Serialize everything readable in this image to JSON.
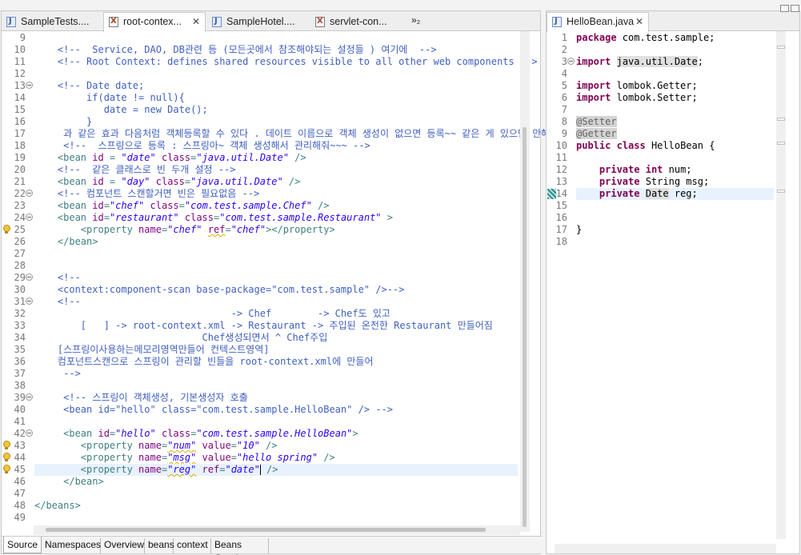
{
  "left_tabs": [
    {
      "label": "SampleTests....",
      "icon": "java-file-icon"
    },
    {
      "label": "root-contex...",
      "icon": "xml-file-icon",
      "active": true
    },
    {
      "label": "SampleHotel....",
      "icon": "java-file-icon"
    },
    {
      "label": "servlet-con...",
      "icon": "xml-file-icon"
    }
  ],
  "tab_overflow": "»₂",
  "tab_close": "✕",
  "right_tab": {
    "label": "HelloBean.java",
    "icon": "java-file-icon"
  },
  "bottom_tabs": [
    "Source",
    "Namespaces",
    "Overview",
    "beans",
    "context",
    "Beans Graph"
  ],
  "xml_lines": [
    {
      "n": "9"
    },
    {
      "n": "10",
      "t": [
        [
          "c",
          "    <!--  Service, DAO, DB관련 등 (모든곳에서 참조해야되는 설정들 ) 여기에  -->"
        ]
      ]
    },
    {
      "n": "11",
      "t": [
        [
          "c",
          "    <!-- Root Context: defines shared resources visible to all other web components -->"
        ]
      ]
    },
    {
      "n": "12"
    },
    {
      "n": "13",
      "fold": true,
      "t": [
        [
          "c",
          "    <!-- Date date;"
        ]
      ]
    },
    {
      "n": "14",
      "t": [
        [
          "c",
          "         if(date != null){"
        ]
      ]
    },
    {
      "n": "15",
      "t": [
        [
          "c",
          "            date = new Date();"
        ]
      ]
    },
    {
      "n": "16",
      "t": [
        [
          "c",
          "         }"
        ]
      ]
    },
    {
      "n": "17",
      "t": [
        [
          "c",
          "     과 같은 효과 다음처럼 객체등록할 수 있다 . 데이트 이름으로 객체 생성이 없으면 등록~~ 같은 게 있으면 안해줌"
        ]
      ]
    },
    {
      "n": "18",
      "t": [
        [
          "c",
          "     <!--  스프링으로 등록 : 스프링아~ 객체 생성해서 관리해줘~~~ -->"
        ]
      ]
    },
    {
      "n": "19",
      "t": [
        [
          "g",
          "    <bean "
        ],
        [
          "a",
          "id"
        ],
        [
          "g",
          " = "
        ],
        [
          "v",
          "\"date\""
        ],
        [
          "g",
          " "
        ],
        [
          "a",
          "class"
        ],
        [
          "g",
          "="
        ],
        [
          "v",
          "\"java.util.Date\""
        ],
        [
          "g",
          " />"
        ]
      ]
    },
    {
      "n": "20",
      "t": [
        [
          "c",
          "    <!--  같은 클래스로 빈 두개 설정 -->"
        ]
      ]
    },
    {
      "n": "21",
      "t": [
        [
          "g",
          "    <bean "
        ],
        [
          "a",
          "id"
        ],
        [
          "g",
          " = "
        ],
        [
          "v",
          "\"day\""
        ],
        [
          "g",
          " "
        ],
        [
          "a",
          "class"
        ],
        [
          "g",
          "="
        ],
        [
          "v",
          "\"java.util.Date\""
        ],
        [
          "g",
          " />"
        ]
      ]
    },
    {
      "n": "22",
      "fold": true,
      "t": [
        [
          "c",
          "    <!-- 컴포넌트 스캔할거면 빈은 필요없음 -->"
        ]
      ]
    },
    {
      "n": "23",
      "t": [
        [
          "g",
          "    <bean "
        ],
        [
          "a",
          "id"
        ],
        [
          "g",
          "="
        ],
        [
          "v",
          "\"chef\""
        ],
        [
          "g",
          " "
        ],
        [
          "a",
          "class"
        ],
        [
          "g",
          "="
        ],
        [
          "v",
          "\"com.test.sample.Chef\""
        ],
        [
          "g",
          " />"
        ]
      ]
    },
    {
      "n": "24",
      "fold": true,
      "t": [
        [
          "g",
          "    <bean "
        ],
        [
          "a",
          "id"
        ],
        [
          "g",
          "="
        ],
        [
          "v",
          "\"restaurant\""
        ],
        [
          "g",
          " "
        ],
        [
          "a",
          "class"
        ],
        [
          "g",
          "="
        ],
        [
          "v",
          "\"com.test.sample.Restaurant\""
        ],
        [
          "g",
          " >"
        ]
      ]
    },
    {
      "n": "25",
      "warn": true,
      "t": [
        [
          "g",
          "        <property "
        ],
        [
          "a",
          "name"
        ],
        [
          "g",
          "="
        ],
        [
          "v",
          "\"chef\""
        ],
        [
          "g",
          " "
        ],
        [
          "as",
          "ref"
        ],
        [
          "g",
          "="
        ],
        [
          "v",
          "\"chef\""
        ],
        [
          "g",
          "></property>"
        ]
      ]
    },
    {
      "n": "26",
      "t": [
        [
          "g",
          "    </bean>"
        ]
      ]
    },
    {
      "n": "27"
    },
    {
      "n": "28"
    },
    {
      "n": "29",
      "fold": true,
      "t": [
        [
          "c",
          "    <!--"
        ]
      ]
    },
    {
      "n": "30",
      "t": [
        [
          "c",
          "    <context:component-scan base-package=\"com.test.sample\" />-->"
        ]
      ]
    },
    {
      "n": "31",
      "fold": true,
      "t": [
        [
          "c",
          "    <!--"
        ]
      ]
    },
    {
      "n": "32",
      "t": [
        [
          "c",
          "                                  -> Chef        -> Chef도 있고"
        ]
      ]
    },
    {
      "n": "33",
      "t": [
        [
          "c",
          "        [   ] -> root-context.xml -> Restaurant -> 주입된 온전한 Restaurant 만들어짐"
        ]
      ]
    },
    {
      "n": "34",
      "t": [
        [
          "c",
          "                             Chef생성되면서 ^ Chef주입"
        ]
      ]
    },
    {
      "n": "35",
      "t": [
        [
          "c",
          "    [스프링이사용하는메모리영역만들어 컨텍스트영역]"
        ]
      ]
    },
    {
      "n": "36",
      "t": [
        [
          "c",
          "    컴포넌트스캔으로 스프링이 관리할 빈들을 root-context.xml에 만들어"
        ]
      ]
    },
    {
      "n": "37",
      "t": [
        [
          "c",
          "     -->"
        ]
      ]
    },
    {
      "n": "38"
    },
    {
      "n": "39",
      "fold": true,
      "t": [
        [
          "c",
          "     <!-- 스프링이 객체생성, 기본생성자 호출"
        ]
      ]
    },
    {
      "n": "40",
      "t": [
        [
          "c",
          "     <bean id=\"hello\" class=\"com.test.sample.HelloBean\" /> -->"
        ]
      ]
    },
    {
      "n": "41"
    },
    {
      "n": "42",
      "fold": true,
      "t": [
        [
          "g",
          "     <bean "
        ],
        [
          "a",
          "id"
        ],
        [
          "g",
          "="
        ],
        [
          "v",
          "\"hello\""
        ],
        [
          "g",
          " "
        ],
        [
          "a",
          "class"
        ],
        [
          "g",
          "="
        ],
        [
          "v",
          "\"com.test.sample.HelloBean\""
        ],
        [
          "g",
          ">"
        ]
      ]
    },
    {
      "n": "43",
      "warn": true,
      "t": [
        [
          "g",
          "        <property "
        ],
        [
          "a",
          "name"
        ],
        [
          "g",
          "="
        ],
        [
          "vs",
          "\"num\""
        ],
        [
          "g",
          " "
        ],
        [
          "a",
          "value"
        ],
        [
          "g",
          "="
        ],
        [
          "v",
          "\"10\""
        ],
        [
          "g",
          " />"
        ]
      ]
    },
    {
      "n": "44",
      "warn": true,
      "t": [
        [
          "g",
          "        <property "
        ],
        [
          "a",
          "name"
        ],
        [
          "g",
          "="
        ],
        [
          "vs",
          "\"msg\""
        ],
        [
          "g",
          " "
        ],
        [
          "a",
          "value"
        ],
        [
          "g",
          "="
        ],
        [
          "v",
          "\"hello spring\""
        ],
        [
          "g",
          " />"
        ]
      ]
    },
    {
      "n": "45",
      "warn": true,
      "hl": true,
      "caret": true,
      "t": [
        [
          "g",
          "        <property "
        ],
        [
          "a",
          "name"
        ],
        [
          "g",
          "="
        ],
        [
          "vs",
          "\"reg\""
        ],
        [
          "g",
          " "
        ],
        [
          "a",
          "ref"
        ],
        [
          "g",
          "="
        ],
        [
          "v",
          "\"date\""
        ],
        [
          "g",
          " />"
        ]
      ]
    },
    {
      "n": "46",
      "t": [
        [
          "g",
          "     </bean>"
        ]
      ]
    },
    {
      "n": "47"
    },
    {
      "n": "48",
      "t": [
        [
          "g",
          "</beans>"
        ]
      ]
    },
    {
      "n": "49"
    }
  ],
  "java_lines": [
    {
      "n": "1",
      "t": [
        [
          "k",
          "package"
        ],
        [
          "p",
          " com.test.sample;"
        ]
      ]
    },
    {
      "n": "2"
    },
    {
      "n": "3",
      "fold": true,
      "t": [
        [
          "k",
          "import"
        ],
        [
          "p",
          " "
        ],
        [
          "i",
          "java.util.Date"
        ],
        [
          "p",
          ";"
        ]
      ]
    },
    {
      "n": "4"
    },
    {
      "n": "5",
      "t": [
        [
          "k",
          "import"
        ],
        [
          "p",
          " lombok.Getter;"
        ]
      ]
    },
    {
      "n": "6",
      "t": [
        [
          "k",
          "import"
        ],
        [
          "p",
          " lombok.Setter;"
        ]
      ]
    },
    {
      "n": "7"
    },
    {
      "n": "8",
      "t": [
        [
          "an",
          "@Setter"
        ]
      ]
    },
    {
      "n": "9",
      "t": [
        [
          "an",
          "@Getter"
        ]
      ]
    },
    {
      "n": "10",
      "t": [
        [
          "k",
          "public"
        ],
        [
          "p",
          " "
        ],
        [
          "k",
          "class"
        ],
        [
          "p",
          " HelloBean {"
        ]
      ]
    },
    {
      "n": "11"
    },
    {
      "n": "12",
      "t": [
        [
          "p",
          "    "
        ],
        [
          "k",
          "private"
        ],
        [
          "p",
          " "
        ],
        [
          "k",
          "int"
        ],
        [
          "p",
          " num;"
        ]
      ]
    },
    {
      "n": "13",
      "t": [
        [
          "p",
          "    "
        ],
        [
          "k",
          "private"
        ],
        [
          "p",
          " String msg;"
        ]
      ]
    },
    {
      "n": "14",
      "hl": true,
      "mark": true,
      "t": [
        [
          "p",
          "    "
        ],
        [
          "k",
          "private"
        ],
        [
          "p",
          " "
        ],
        [
          "i",
          "Date"
        ],
        [
          "p",
          " reg;"
        ]
      ]
    },
    {
      "n": "15"
    },
    {
      "n": "16"
    },
    {
      "n": "17",
      "t": [
        [
          "p",
          "}"
        ]
      ]
    },
    {
      "n": "18"
    }
  ]
}
